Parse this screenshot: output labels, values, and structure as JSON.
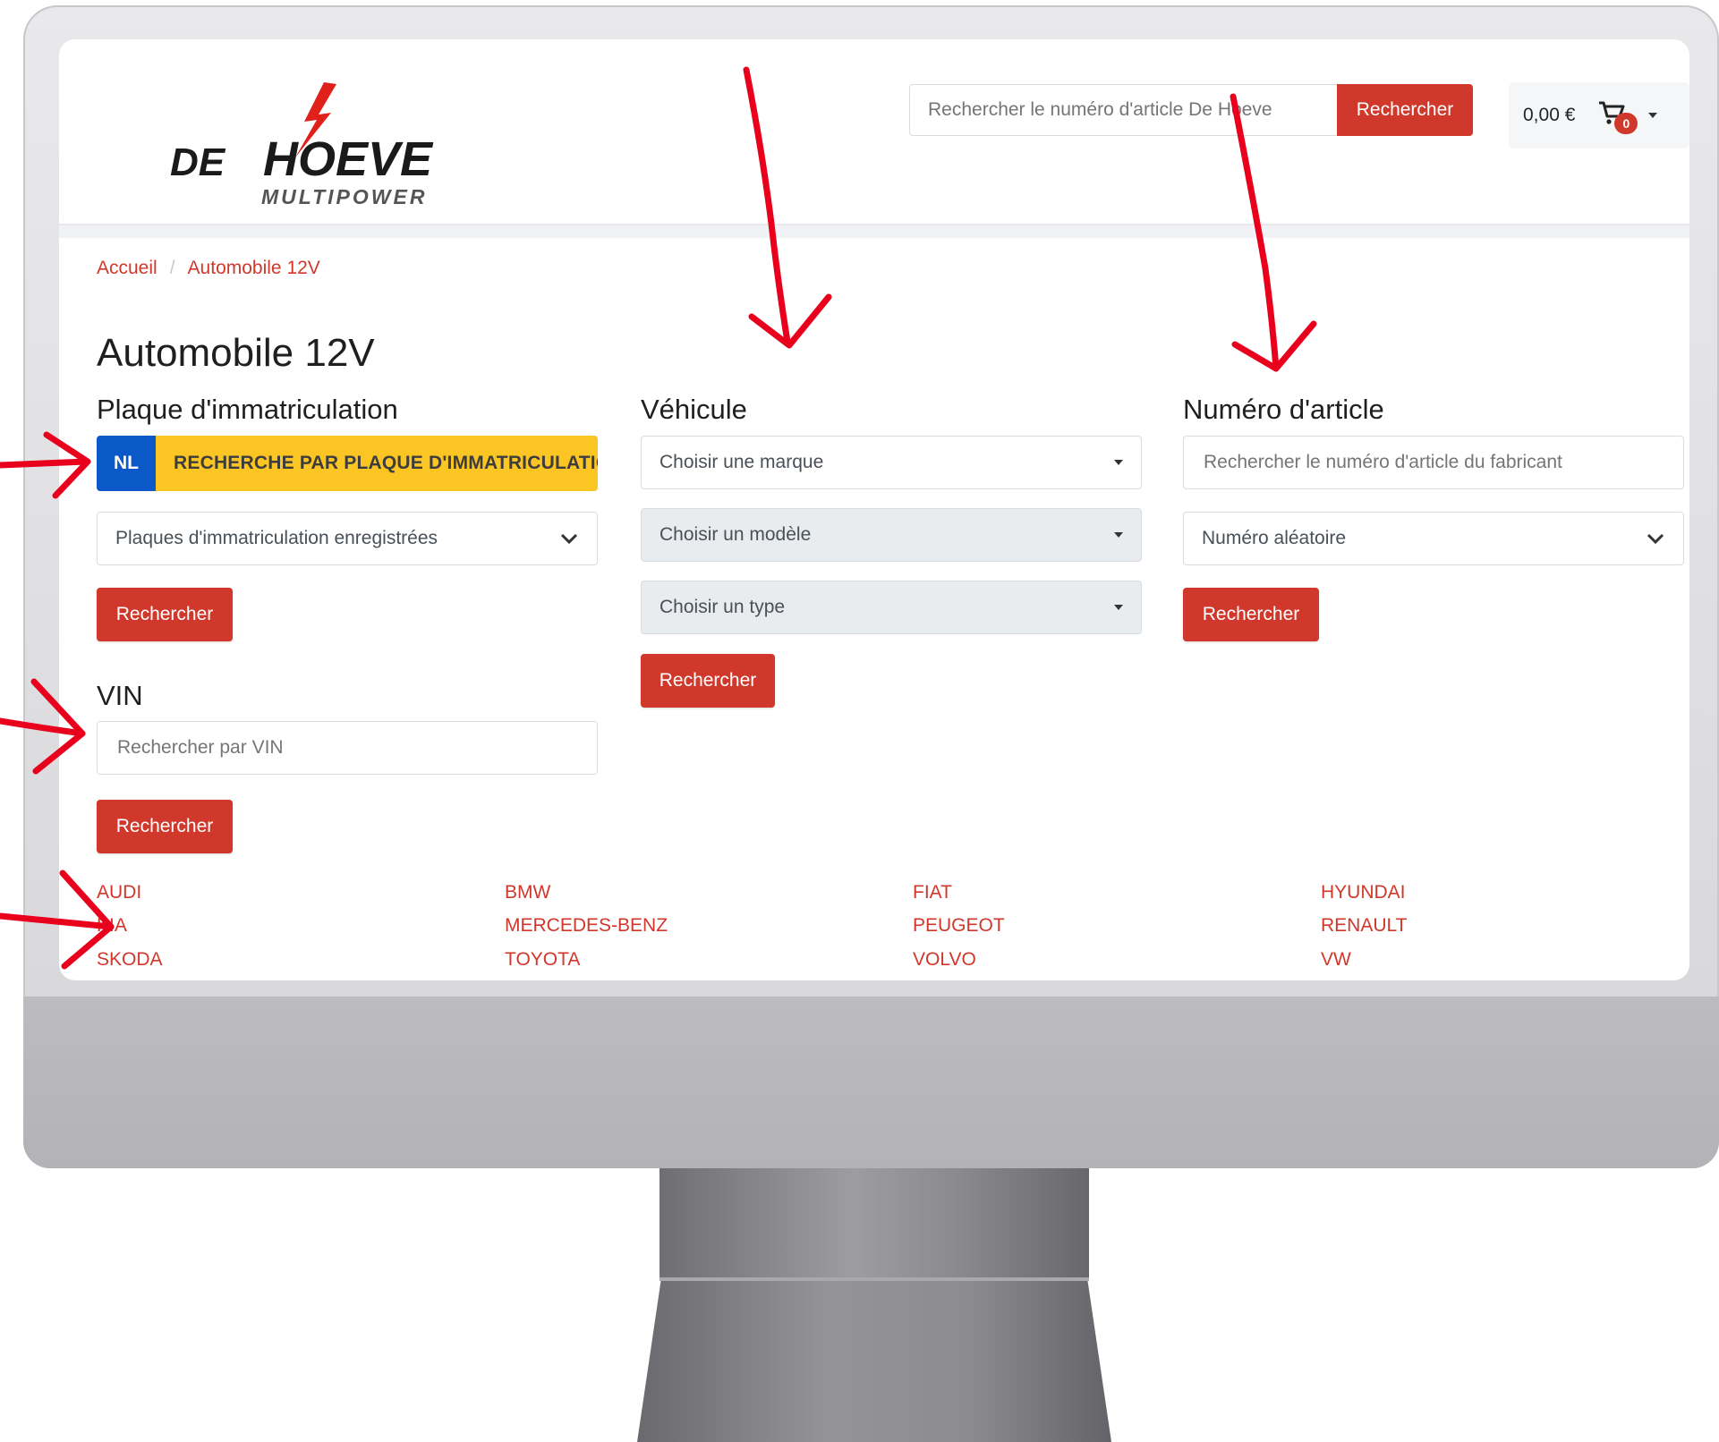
{
  "header": {
    "logo_word_de": "DE",
    "logo_word_hoeve": "HOEVE",
    "logo_sub": "MULTIPOWER",
    "search_placeholder": "Rechercher le numéro d'article De Hoeve",
    "search_button": "Rechercher",
    "cart_total": "0,00 €",
    "cart_count": "0"
  },
  "breadcrumb": {
    "home": "Accueil",
    "separator": "/",
    "current": "Automobile 12V"
  },
  "page": {
    "title": "Automobile 12V"
  },
  "plate_section": {
    "heading": "Plaque d'immatriculation",
    "country": "NL",
    "plate_button": "RECHERCHE PAR PLAQUE D'IMMATRICULATION",
    "saved_plates_select": "Plaques d'immatriculation enregistrées",
    "search_button": "Rechercher"
  },
  "vin_section": {
    "heading": "VIN",
    "placeholder": "Rechercher par VIN",
    "search_button": "Rechercher"
  },
  "vehicle_section": {
    "heading": "Véhicule",
    "brand_select": "Choisir une marque",
    "model_select": "Choisir un modèle",
    "type_select": "Choisir un type",
    "search_button": "Rechercher"
  },
  "article_section": {
    "heading": "Numéro d'article",
    "placeholder": "Rechercher le numéro d'article du fabricant",
    "random_select": "Numéro aléatoire",
    "search_button": "Rechercher"
  },
  "brands": {
    "audi": "AUDI",
    "bmw": "BMW",
    "fiat": "FIAT",
    "hyundai": "HYUNDAI",
    "kia": "KIA",
    "mercedes": "MERCEDES-BENZ",
    "peugeot": "PEUGEOT",
    "renault": "RENAULT",
    "skoda": "SKODA",
    "toyota": "TOYOTA",
    "volvo": "VOLVO",
    "vw": "VW"
  },
  "colors": {
    "accent_red": "#d0382b",
    "plate_blue": "#0b59c8",
    "plate_yellow": "#fbc624",
    "annotation_red": "#e8001c"
  }
}
